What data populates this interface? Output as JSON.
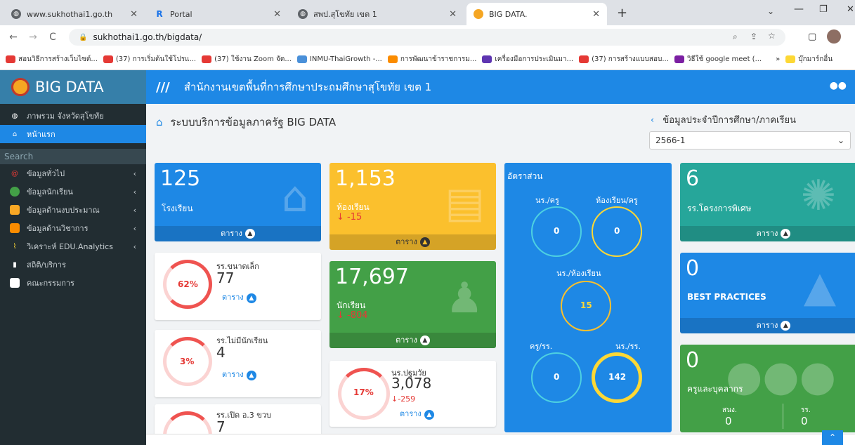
{
  "browser": {
    "tabs": [
      {
        "title": "www.sukhothai1.go.th",
        "favicon_color": "#5f6368"
      },
      {
        "title": "Portal",
        "favicon_color": "#1a73e8"
      },
      {
        "title": "สพป.สุโขทัย เขต 1",
        "favicon_color": "#5f6368"
      },
      {
        "title": "BIG DATA.",
        "favicon_color": "#f5a623"
      }
    ],
    "url": "sukhothai1.go.th/bigdata/",
    "bookmarks": [
      "สอนวิธีการสร้างเว็บไซต์...",
      "(37) การเริ่มต้นใช้โปรแ...",
      "(37) ใช้งาน Zoom จัด...",
      "INMU-ThaiGrowth -...",
      "การพัฒนาข้าราชการม...",
      "เครื่องมือการประเมินมา...",
      "(37) การสร้างแบบสอบ...",
      "วิธีใช้ google meet (...",
      "บุ๊กมาร์กอื่น"
    ]
  },
  "sidebar": {
    "logo": "BIG DATA",
    "items": [
      {
        "label": "ภาพรวม จังหวัดสุโขทัย",
        "icon": "globe-icon"
      },
      {
        "label": "หน้าแรก",
        "icon": "home-icon"
      }
    ],
    "search_label": "Search",
    "menu": [
      {
        "label": "ข้อมูลทั่วไป",
        "icon": "at-icon",
        "color": "#e53935"
      },
      {
        "label": "ข้อมูลนักเรียน",
        "icon": "student-icon",
        "color": "#43a047"
      },
      {
        "label": "ข้อมูลด้านงบประมาณ",
        "icon": "budget-icon",
        "color": "#f9a825"
      },
      {
        "label": "ข้อมูลด้านวิชาการ",
        "icon": "academic-icon",
        "color": "#fb8c00"
      },
      {
        "label": "วิเคราะห์ EDU.Analytics",
        "icon": "chart-icon",
        "color": "#fdd835"
      },
      {
        "label": "สถิติ/บริการ",
        "icon": "thumbs-up-icon",
        "color": "#ffffff"
      },
      {
        "label": "คณะกรรมการ",
        "icon": "id-card-icon",
        "color": "#ffffff"
      }
    ]
  },
  "header": {
    "title": "สำนักงานเขตพื้นที่การศึกษาประถมศึกษาสุโขทัย เขต 1"
  },
  "page": {
    "title": "ระบบบริการข้อมูลภาครัฐ BIG DATA",
    "semester_label": "ข้อมูลประจำปีการศึกษา/ภาคเรียน",
    "semester_value": "2566-1"
  },
  "table_link": "ตาราง",
  "cards": {
    "schools": {
      "value": "125",
      "label": "โรงเรียน",
      "color": "#1e88e5"
    },
    "classrooms": {
      "value": "1,153",
      "label": "ห้องเรียน",
      "change": "-15",
      "color": "#fbc02d"
    },
    "students": {
      "value": "17,697",
      "label": "นักเรียน",
      "change": "-804",
      "color": "#43a047"
    },
    "ratio": {
      "title": "อัตราส่วน",
      "items": [
        {
          "label": "นร./ครู",
          "value": "0"
        },
        {
          "label": "ห้องเรียน/ครู",
          "value": "0"
        },
        {
          "label": "นร./ห้องเรียน",
          "value": "15"
        },
        {
          "label": "ครู/รร.",
          "value": "0"
        },
        {
          "label": "นร./รร.",
          "value": "142"
        }
      ],
      "color": "#1e88e5"
    },
    "special": {
      "value": "6",
      "label": "รร.โครงการพิเศษ",
      "color": "#26a69a"
    },
    "best_practices": {
      "value": "0",
      "label": "BEST PRACTICES",
      "color": "#1e88e5"
    },
    "staff": {
      "value": "0",
      "label": "ครูและบุคลากร",
      "sub": [
        {
          "label": "สนง.",
          "value": "0"
        },
        {
          "label": "รร.",
          "value": "0"
        }
      ],
      "color": "#43a047"
    }
  },
  "white_cards": [
    {
      "label": "รร.ขนาดเล็ก",
      "value": "77",
      "percent": "62%"
    },
    {
      "label": "รร.ไม่มีนักเรียน",
      "value": "4",
      "percent": "3%"
    },
    {
      "label": "รร.เปิด อ.3 ขวบ",
      "value": "7"
    }
  ],
  "preschool": {
    "label": "นร.ปฐมวัย",
    "value": "3,078",
    "percent": "17%",
    "change": "-259"
  }
}
